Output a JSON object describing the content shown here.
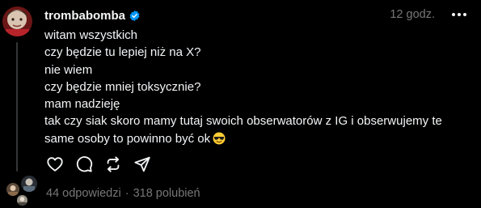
{
  "post": {
    "username": "trombabomba",
    "time": "12 godz.",
    "lines": [
      "witam wszystkich",
      "czy będzie tu lepiej niż na X?",
      "nie wiem",
      "czy będzie mniej toksycznie?",
      "mam nadzieję",
      "tak czy siak skoro mamy tutaj swoich obserwatorów z IG i obserwujemy te",
      "same osoby to powinno być ok"
    ],
    "emoji": "smiling-face-with-sunglasses"
  },
  "stats": {
    "replies": "44 odpowiedzi",
    "separator": "·",
    "likes": "318 polubień"
  },
  "colors": {
    "background": "#000000",
    "text": "#f3f5f7",
    "secondary": "#777777",
    "verified": "#0095f6",
    "thread_line": "#333638"
  },
  "icons": {
    "more": "more-icon",
    "like": "heart-icon",
    "reply": "comment-icon",
    "repost": "repost-icon",
    "share": "send-icon",
    "verified": "verified-badge-icon"
  }
}
